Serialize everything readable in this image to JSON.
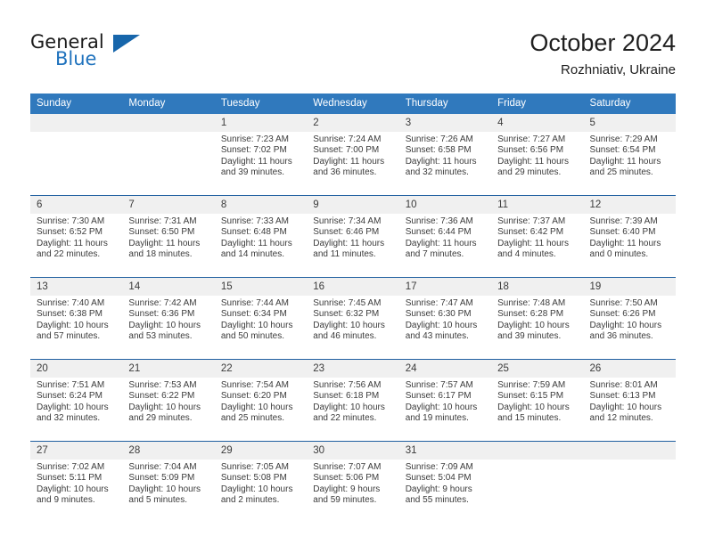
{
  "brand": {
    "word_one": "General",
    "word_two": "Blue",
    "logo_icon": "triangle-logo-icon"
  },
  "header": {
    "title": "October 2024",
    "subtitle": "Rozhniativ, Ukraine"
  },
  "colors": {
    "header_blue": "#3079bd",
    "separator_blue": "#1f5fa0",
    "daynum_band": "#f0f0f0",
    "brand_blue": "#1f72bd"
  },
  "weekday_headers": [
    "Sunday",
    "Monday",
    "Tuesday",
    "Wednesday",
    "Thursday",
    "Friday",
    "Saturday"
  ],
  "weeks": [
    {
      "days": [
        {
          "date": "",
          "sunrise": "",
          "sunset": "",
          "daylight_a": "",
          "daylight_b": ""
        },
        {
          "date": "",
          "sunrise": "",
          "sunset": "",
          "daylight_a": "",
          "daylight_b": ""
        },
        {
          "date": "1",
          "sunrise": "Sunrise: 7:23 AM",
          "sunset": "Sunset: 7:02 PM",
          "daylight_a": "Daylight: 11 hours",
          "daylight_b": "and 39 minutes."
        },
        {
          "date": "2",
          "sunrise": "Sunrise: 7:24 AM",
          "sunset": "Sunset: 7:00 PM",
          "daylight_a": "Daylight: 11 hours",
          "daylight_b": "and 36 minutes."
        },
        {
          "date": "3",
          "sunrise": "Sunrise: 7:26 AM",
          "sunset": "Sunset: 6:58 PM",
          "daylight_a": "Daylight: 11 hours",
          "daylight_b": "and 32 minutes."
        },
        {
          "date": "4",
          "sunrise": "Sunrise: 7:27 AM",
          "sunset": "Sunset: 6:56 PM",
          "daylight_a": "Daylight: 11 hours",
          "daylight_b": "and 29 minutes."
        },
        {
          "date": "5",
          "sunrise": "Sunrise: 7:29 AM",
          "sunset": "Sunset: 6:54 PM",
          "daylight_a": "Daylight: 11 hours",
          "daylight_b": "and 25 minutes."
        }
      ]
    },
    {
      "days": [
        {
          "date": "6",
          "sunrise": "Sunrise: 7:30 AM",
          "sunset": "Sunset: 6:52 PM",
          "daylight_a": "Daylight: 11 hours",
          "daylight_b": "and 22 minutes."
        },
        {
          "date": "7",
          "sunrise": "Sunrise: 7:31 AM",
          "sunset": "Sunset: 6:50 PM",
          "daylight_a": "Daylight: 11 hours",
          "daylight_b": "and 18 minutes."
        },
        {
          "date": "8",
          "sunrise": "Sunrise: 7:33 AM",
          "sunset": "Sunset: 6:48 PM",
          "daylight_a": "Daylight: 11 hours",
          "daylight_b": "and 14 minutes."
        },
        {
          "date": "9",
          "sunrise": "Sunrise: 7:34 AM",
          "sunset": "Sunset: 6:46 PM",
          "daylight_a": "Daylight: 11 hours",
          "daylight_b": "and 11 minutes."
        },
        {
          "date": "10",
          "sunrise": "Sunrise: 7:36 AM",
          "sunset": "Sunset: 6:44 PM",
          "daylight_a": "Daylight: 11 hours",
          "daylight_b": "and 7 minutes."
        },
        {
          "date": "11",
          "sunrise": "Sunrise: 7:37 AM",
          "sunset": "Sunset: 6:42 PM",
          "daylight_a": "Daylight: 11 hours",
          "daylight_b": "and 4 minutes."
        },
        {
          "date": "12",
          "sunrise": "Sunrise: 7:39 AM",
          "sunset": "Sunset: 6:40 PM",
          "daylight_a": "Daylight: 11 hours",
          "daylight_b": "and 0 minutes."
        }
      ]
    },
    {
      "days": [
        {
          "date": "13",
          "sunrise": "Sunrise: 7:40 AM",
          "sunset": "Sunset: 6:38 PM",
          "daylight_a": "Daylight: 10 hours",
          "daylight_b": "and 57 minutes."
        },
        {
          "date": "14",
          "sunrise": "Sunrise: 7:42 AM",
          "sunset": "Sunset: 6:36 PM",
          "daylight_a": "Daylight: 10 hours",
          "daylight_b": "and 53 minutes."
        },
        {
          "date": "15",
          "sunrise": "Sunrise: 7:44 AM",
          "sunset": "Sunset: 6:34 PM",
          "daylight_a": "Daylight: 10 hours",
          "daylight_b": "and 50 minutes."
        },
        {
          "date": "16",
          "sunrise": "Sunrise: 7:45 AM",
          "sunset": "Sunset: 6:32 PM",
          "daylight_a": "Daylight: 10 hours",
          "daylight_b": "and 46 minutes."
        },
        {
          "date": "17",
          "sunrise": "Sunrise: 7:47 AM",
          "sunset": "Sunset: 6:30 PM",
          "daylight_a": "Daylight: 10 hours",
          "daylight_b": "and 43 minutes."
        },
        {
          "date": "18",
          "sunrise": "Sunrise: 7:48 AM",
          "sunset": "Sunset: 6:28 PM",
          "daylight_a": "Daylight: 10 hours",
          "daylight_b": "and 39 minutes."
        },
        {
          "date": "19",
          "sunrise": "Sunrise: 7:50 AM",
          "sunset": "Sunset: 6:26 PM",
          "daylight_a": "Daylight: 10 hours",
          "daylight_b": "and 36 minutes."
        }
      ]
    },
    {
      "days": [
        {
          "date": "20",
          "sunrise": "Sunrise: 7:51 AM",
          "sunset": "Sunset: 6:24 PM",
          "daylight_a": "Daylight: 10 hours",
          "daylight_b": "and 32 minutes."
        },
        {
          "date": "21",
          "sunrise": "Sunrise: 7:53 AM",
          "sunset": "Sunset: 6:22 PM",
          "daylight_a": "Daylight: 10 hours",
          "daylight_b": "and 29 minutes."
        },
        {
          "date": "22",
          "sunrise": "Sunrise: 7:54 AM",
          "sunset": "Sunset: 6:20 PM",
          "daylight_a": "Daylight: 10 hours",
          "daylight_b": "and 25 minutes."
        },
        {
          "date": "23",
          "sunrise": "Sunrise: 7:56 AM",
          "sunset": "Sunset: 6:18 PM",
          "daylight_a": "Daylight: 10 hours",
          "daylight_b": "and 22 minutes."
        },
        {
          "date": "24",
          "sunrise": "Sunrise: 7:57 AM",
          "sunset": "Sunset: 6:17 PM",
          "daylight_a": "Daylight: 10 hours",
          "daylight_b": "and 19 minutes."
        },
        {
          "date": "25",
          "sunrise": "Sunrise: 7:59 AM",
          "sunset": "Sunset: 6:15 PM",
          "daylight_a": "Daylight: 10 hours",
          "daylight_b": "and 15 minutes."
        },
        {
          "date": "26",
          "sunrise": "Sunrise: 8:01 AM",
          "sunset": "Sunset: 6:13 PM",
          "daylight_a": "Daylight: 10 hours",
          "daylight_b": "and 12 minutes."
        }
      ]
    },
    {
      "days": [
        {
          "date": "27",
          "sunrise": "Sunrise: 7:02 AM",
          "sunset": "Sunset: 5:11 PM",
          "daylight_a": "Daylight: 10 hours",
          "daylight_b": "and 9 minutes."
        },
        {
          "date": "28",
          "sunrise": "Sunrise: 7:04 AM",
          "sunset": "Sunset: 5:09 PM",
          "daylight_a": "Daylight: 10 hours",
          "daylight_b": "and 5 minutes."
        },
        {
          "date": "29",
          "sunrise": "Sunrise: 7:05 AM",
          "sunset": "Sunset: 5:08 PM",
          "daylight_a": "Daylight: 10 hours",
          "daylight_b": "and 2 minutes."
        },
        {
          "date": "30",
          "sunrise": "Sunrise: 7:07 AM",
          "sunset": "Sunset: 5:06 PM",
          "daylight_a": "Daylight: 9 hours",
          "daylight_b": "and 59 minutes."
        },
        {
          "date": "31",
          "sunrise": "Sunrise: 7:09 AM",
          "sunset": "Sunset: 5:04 PM",
          "daylight_a": "Daylight: 9 hours",
          "daylight_b": "and 55 minutes."
        },
        {
          "date": "",
          "sunrise": "",
          "sunset": "",
          "daylight_a": "",
          "daylight_b": ""
        },
        {
          "date": "",
          "sunrise": "",
          "sunset": "",
          "daylight_a": "",
          "daylight_b": ""
        }
      ]
    }
  ]
}
